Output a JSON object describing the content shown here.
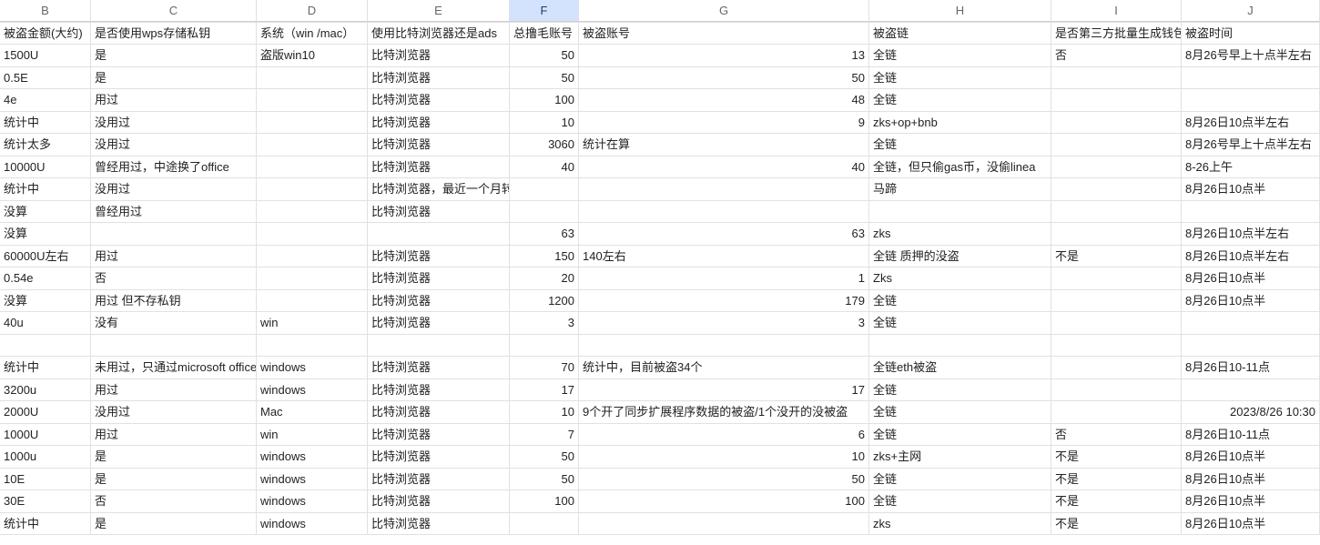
{
  "columns": [
    {
      "id": "B",
      "letter": "B",
      "cls": "cB",
      "selected": false
    },
    {
      "id": "C",
      "letter": "C",
      "cls": "cC",
      "selected": false
    },
    {
      "id": "D",
      "letter": "D",
      "cls": "cD",
      "selected": false
    },
    {
      "id": "E",
      "letter": "E",
      "cls": "cE",
      "selected": false
    },
    {
      "id": "F",
      "letter": "F",
      "cls": "cF",
      "selected": true
    },
    {
      "id": "G",
      "letter": "G",
      "cls": "cG",
      "selected": false
    },
    {
      "id": "H",
      "letter": "H",
      "cls": "cH",
      "selected": false
    },
    {
      "id": "I",
      "letter": "I",
      "cls": "cI",
      "selected": false
    },
    {
      "id": "J",
      "letter": "J",
      "cls": "cJ",
      "selected": false
    }
  ],
  "numeric_cols": [
    "F",
    "G",
    "J"
  ],
  "header_row": {
    "B": "被盗金额(大约)",
    "C": "是否使用wps存储私钥",
    "D": "系统（win /mac）",
    "E": "使用比特浏览器还是ads",
    "F": "总撸毛账号",
    "G": "被盗账号",
    "H": "被盗链",
    "I": "是否第三方批量生成钱包",
    "J": "被盗时间"
  },
  "rows": [
    {
      "B": "1500U",
      "C": "是",
      "D": "盗版win10",
      "E": "比特浏览器",
      "F": "50",
      "G": "13",
      "H": "全链",
      "I": "否",
      "J": "8月26号早上十点半左右"
    },
    {
      "B": "0.5E",
      "C": "是",
      "D": "",
      "E": "比特浏览器",
      "F": "50",
      "G": "50",
      "H": "全链",
      "I": "",
      "J": ""
    },
    {
      "B": "4e",
      "C": "用过",
      "D": "",
      "E": "比特浏览器",
      "F": "100",
      "G": "48",
      "H": "全链",
      "I": "",
      "J": ""
    },
    {
      "B": "统计中",
      "C": "没用过",
      "D": "",
      "E": "比特浏览器",
      "F": "10",
      "G": "9",
      "H": "zks+op+bnb",
      "I": "",
      "J": "8月26日10点半左右"
    },
    {
      "B": "统计太多",
      "C": "没用过",
      "D": "",
      "E": "比特浏览器",
      "F": "3060",
      "G": "统计在算",
      "H": "全链",
      "I": "",
      "J": "8月26号早上十点半左右"
    },
    {
      "B": "10000U",
      "C": "曾经用过，中途换了office",
      "D": "",
      "E": "比特浏览器",
      "F": "40",
      "G": "40",
      "H": "全链，但只偷gas币，没偷linea",
      "I": "",
      "J": "8-26上午"
    },
    {
      "B": "统计中",
      "C": "没用过",
      "D": "",
      "E": "比特浏览器，最近一个月转为ads",
      "F": "",
      "G": "",
      "H": "马蹄",
      "I": "",
      "J": "8月26日10点半"
    },
    {
      "B": "没算",
      "C": "曾经用过",
      "D": "",
      "E": "比特浏览器",
      "F": "",
      "G": "",
      "H": "",
      "I": "",
      "J": ""
    },
    {
      "B": "没算",
      "C": "",
      "D": "",
      "E": "",
      "F": "63",
      "G": "63",
      "H": "zks",
      "I": "",
      "J": "8月26日10点半左右"
    },
    {
      "B": "60000U左右",
      "C": "用过",
      "D": "",
      "E": "比特浏览器",
      "F": "150",
      "G": "140左右",
      "H": "全链 质押的没盗",
      "I": "不是",
      "J": "8月26日10点半左右"
    },
    {
      "B": "0.54e",
      "C": "否",
      "D": "",
      "E": "比特浏览器",
      "F": "20",
      "G": "1",
      "H": "Zks",
      "I": "",
      "J": "8月26日10点半"
    },
    {
      "B": "没算",
      "C": "用过 但不存私钥",
      "D": "",
      "E": "比特浏览器",
      "F": "1200",
      "G": "179",
      "H": "全链",
      "I": "",
      "J": "8月26日10点半"
    },
    {
      "B": "40u",
      "C": "没有",
      "D": "win",
      "E": "比特浏览器",
      "F": "3",
      "G": "3",
      "H": "全链",
      "I": "",
      "J": ""
    },
    {
      "B": "",
      "C": "",
      "D": "",
      "E": "",
      "F": "",
      "G": "",
      "H": "",
      "I": "",
      "J": ""
    },
    {
      "B": "统计中",
      "C": "未用过，只通过microsoft office",
      "D": "windows",
      "E": "比特浏览器",
      "F": "70",
      "G": "统计中，目前被盗34个",
      "H": "全链eth被盗",
      "I": "",
      "J": "8月26日10-11点"
    },
    {
      "B": "3200u",
      "C": "用过",
      "D": "windows",
      "E": "比特浏览器",
      "F": "17",
      "G": "17",
      "H": "全链",
      "I": "",
      "J": ""
    },
    {
      "B": "2000U",
      "C": "没用过",
      "D": "Mac",
      "E": "比特浏览器",
      "F": "10",
      "G": "9个开了同步扩展程序数据的被盗/1个没开的没被盗",
      "H": "全链",
      "I": "",
      "J": "2023/8/26 10:30"
    },
    {
      "B": "1000U",
      "C": "用过",
      "D": "win",
      "E": "比特浏览器",
      "F": "7",
      "G": "6",
      "H": "全链",
      "I": "否",
      "J": "8月26日10-11点"
    },
    {
      "B": "1000u",
      "C": "是",
      "D": "windows",
      "E": "比特浏览器",
      "F": "50",
      "G": "10",
      "H": "zks+主网",
      "I": "不是",
      "J": "8月26日10点半"
    },
    {
      "B": "10E",
      "C": "是",
      "D": "windows",
      "E": "比特浏览器",
      "F": "50",
      "G": "50",
      "H": "全链",
      "I": "不是",
      "J": "8月26日10点半"
    },
    {
      "B": "30E",
      "C": "否",
      "D": "windows",
      "E": "比特浏览器",
      "F": "100",
      "G": "100",
      "H": "全链",
      "I": "不是",
      "J": "8月26日10点半"
    },
    {
      "B": "统计中",
      "C": "是",
      "D": "windows",
      "E": "比特浏览器",
      "F": "",
      "G": "",
      "H": "zks",
      "I": "不是",
      "J": "8月26日10点半"
    }
  ]
}
